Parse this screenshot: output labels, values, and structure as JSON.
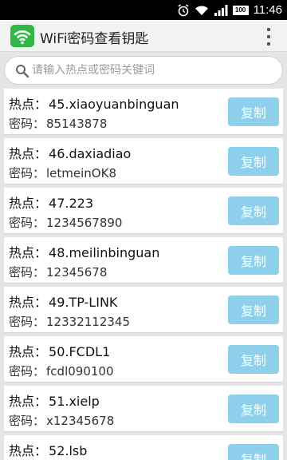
{
  "status_bar": {
    "time": "11:46",
    "battery": "100",
    "icons": [
      "alarm-icon",
      "wifi-icon",
      "signal-icon",
      "battery-icon"
    ]
  },
  "app_bar": {
    "title": "WiFi密码查看钥匙",
    "icon": "wifi-app-icon",
    "menu_icon": "overflow-menu-icon",
    "accent": "#2fb844"
  },
  "search": {
    "placeholder": "请输入热点或密码关键词",
    "value": ""
  },
  "labels": {
    "hotspot": "热点：",
    "password": "密码：",
    "copy": "复制"
  },
  "entries": [
    {
      "hotspot": "45.xiaoyuanbinguan",
      "password": "85143878"
    },
    {
      "hotspot": "46.daxiadiao",
      "password": "letmeinOK8"
    },
    {
      "hotspot": "47.223",
      "password": "1234567890"
    },
    {
      "hotspot": "48.meilinbinguan",
      "password": "12345678"
    },
    {
      "hotspot": "49.TP-LINK",
      "password": "12332112345"
    },
    {
      "hotspot": "50.FCDL1",
      "password": "fcdl090100"
    },
    {
      "hotspot": "51.xielp",
      "password": "x12345678"
    },
    {
      "hotspot": "52.lsb",
      "password": ""
    }
  ],
  "colors": {
    "copy_button": "#8ed0ec",
    "background": "#e5e5e5"
  }
}
